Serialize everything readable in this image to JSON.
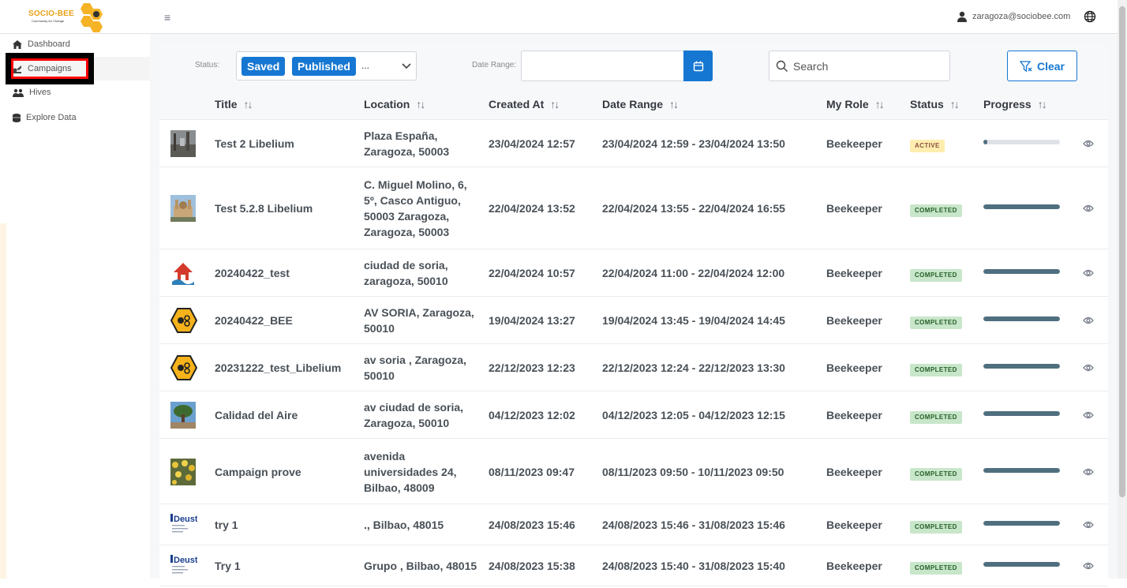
{
  "app": {
    "logo_text": "SOCIO-BEE",
    "logo_sub": "Community for Change",
    "user_email": "zaragoza@sociobee.com"
  },
  "sidebar": {
    "items": [
      {
        "label": "Dashboard",
        "icon": "home-icon"
      },
      {
        "label": "Campaigns",
        "icon": "campaigns-icon"
      },
      {
        "label": "Hives",
        "icon": "users-icon"
      },
      {
        "label": "Explore Data",
        "icon": "database-icon"
      }
    ],
    "active_index": 1
  },
  "filters": {
    "status_label": "Status:",
    "status_chips": [
      "Saved",
      "Published"
    ],
    "status_more": "...",
    "date_range_label": "Date Range:",
    "date_range_value": "",
    "search_placeholder": "Search",
    "clear_label": "Clear"
  },
  "table": {
    "columns": [
      "Title",
      "Location",
      "Created At",
      "Date Range",
      "My Role",
      "Status",
      "Progress"
    ],
    "rows": [
      {
        "title": "Test 2 Libelium",
        "location": "Plaza España, Zaragoza, 50003",
        "created_at": "23/04/2024 12:57",
        "date_range": "23/04/2024 12:59 - 23/04/2024 13:50",
        "role": "Beekeeper",
        "status": "ACTIVE",
        "progress": 5,
        "thumb": "photo-plaza"
      },
      {
        "title": "Test 5.2.8 Libelium",
        "location": "C. Miguel Molino, 6, 5º, Casco Antiguo, 50003 Zaragoza, Zaragoza, 50003",
        "created_at": "22/04/2024 13:52",
        "date_range": "22/04/2024 13:55 - 22/04/2024 16:55",
        "role": "Beekeeper",
        "status": "COMPLETED",
        "progress": 100,
        "thumb": "photo-basilica"
      },
      {
        "title": "20240422_test",
        "location": "ciudad de soria, zaragoza, 50010",
        "created_at": "22/04/2024 10:57",
        "date_range": "22/04/2024 11:00 - 22/04/2024 12:00",
        "role": "Beekeeper",
        "status": "COMPLETED",
        "progress": 100,
        "thumb": "house-logo"
      },
      {
        "title": "20240422_BEE",
        "location": "AV SORIA, Zaragoza, 50010",
        "created_at": "19/04/2024 13:27",
        "date_range": "19/04/2024 13:45 - 19/04/2024 14:45",
        "role": "Beekeeper",
        "status": "COMPLETED",
        "progress": 100,
        "thumb": "bee-hex-logo"
      },
      {
        "title": "20231222_test_Libelium",
        "location": "av soria , Zaragoza, 50010",
        "created_at": "22/12/2023 12:23",
        "date_range": "22/12/2023 12:24 - 22/12/2023 13:30",
        "role": "Beekeeper",
        "status": "COMPLETED",
        "progress": 100,
        "thumb": "bee-hex-logo"
      },
      {
        "title": "Calidad del Aire",
        "location": "av ciudad de soria, Zaragoza, 50010",
        "created_at": "04/12/2023 12:02",
        "date_range": "04/12/2023 12:05 - 04/12/2023 12:15",
        "role": "Beekeeper",
        "status": "COMPLETED",
        "progress": 100,
        "thumb": "photo-tree"
      },
      {
        "title": "Campaign prove",
        "location": "avenida universidades 24, Bilbao, 48009",
        "created_at": "08/11/2023 09:47",
        "date_range": "08/11/2023 09:50 - 10/11/2023 09:50",
        "role": "Beekeeper",
        "status": "COMPLETED",
        "progress": 100,
        "thumb": "photo-flowers"
      },
      {
        "title": "try 1",
        "location": "., Bilbao, 48015",
        "created_at": "24/08/2023 15:46",
        "date_range": "24/08/2023 15:46 - 31/08/2023 15:46",
        "role": "Beekeeper",
        "status": "COMPLETED",
        "progress": 100,
        "thumb": "deusto-logo"
      },
      {
        "title": "Try 1",
        "location": "Grupo , Bilbao, 48015",
        "created_at": "24/08/2023 15:38",
        "date_range": "24/08/2023 15:40 - 31/08/2023 15:40",
        "role": "Beekeeper",
        "status": "COMPLETED",
        "progress": 100,
        "thumb": "deusto-logo"
      }
    ]
  },
  "thumb_labels": {
    "deusto": "Deusto"
  },
  "colors": {
    "primary": "#1677d2",
    "completed_bg": "#c8e6c9",
    "active_bg": "#feedaf",
    "progress": "#4f6f7f",
    "highlight": "#ff0000"
  }
}
